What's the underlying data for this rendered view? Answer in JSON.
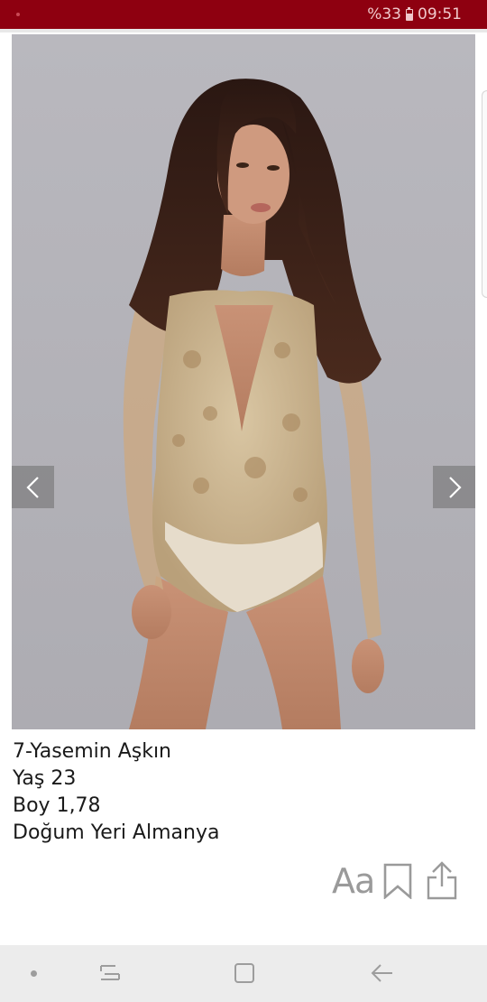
{
  "status_bar": {
    "battery_percent": "%33",
    "time": "09:51"
  },
  "article": {
    "caption_lines": [
      "7-Yasemin Aşkın",
      "Yaş 23",
      "Boy 1,78",
      "Doğum Yeri Almanya"
    ]
  },
  "actions": {
    "font_size_label": "Aa"
  },
  "colors": {
    "status_bar_bg": "#8e0010",
    "nav_bar_bg": "#ececec",
    "action_icon": "#9a9a9a"
  }
}
